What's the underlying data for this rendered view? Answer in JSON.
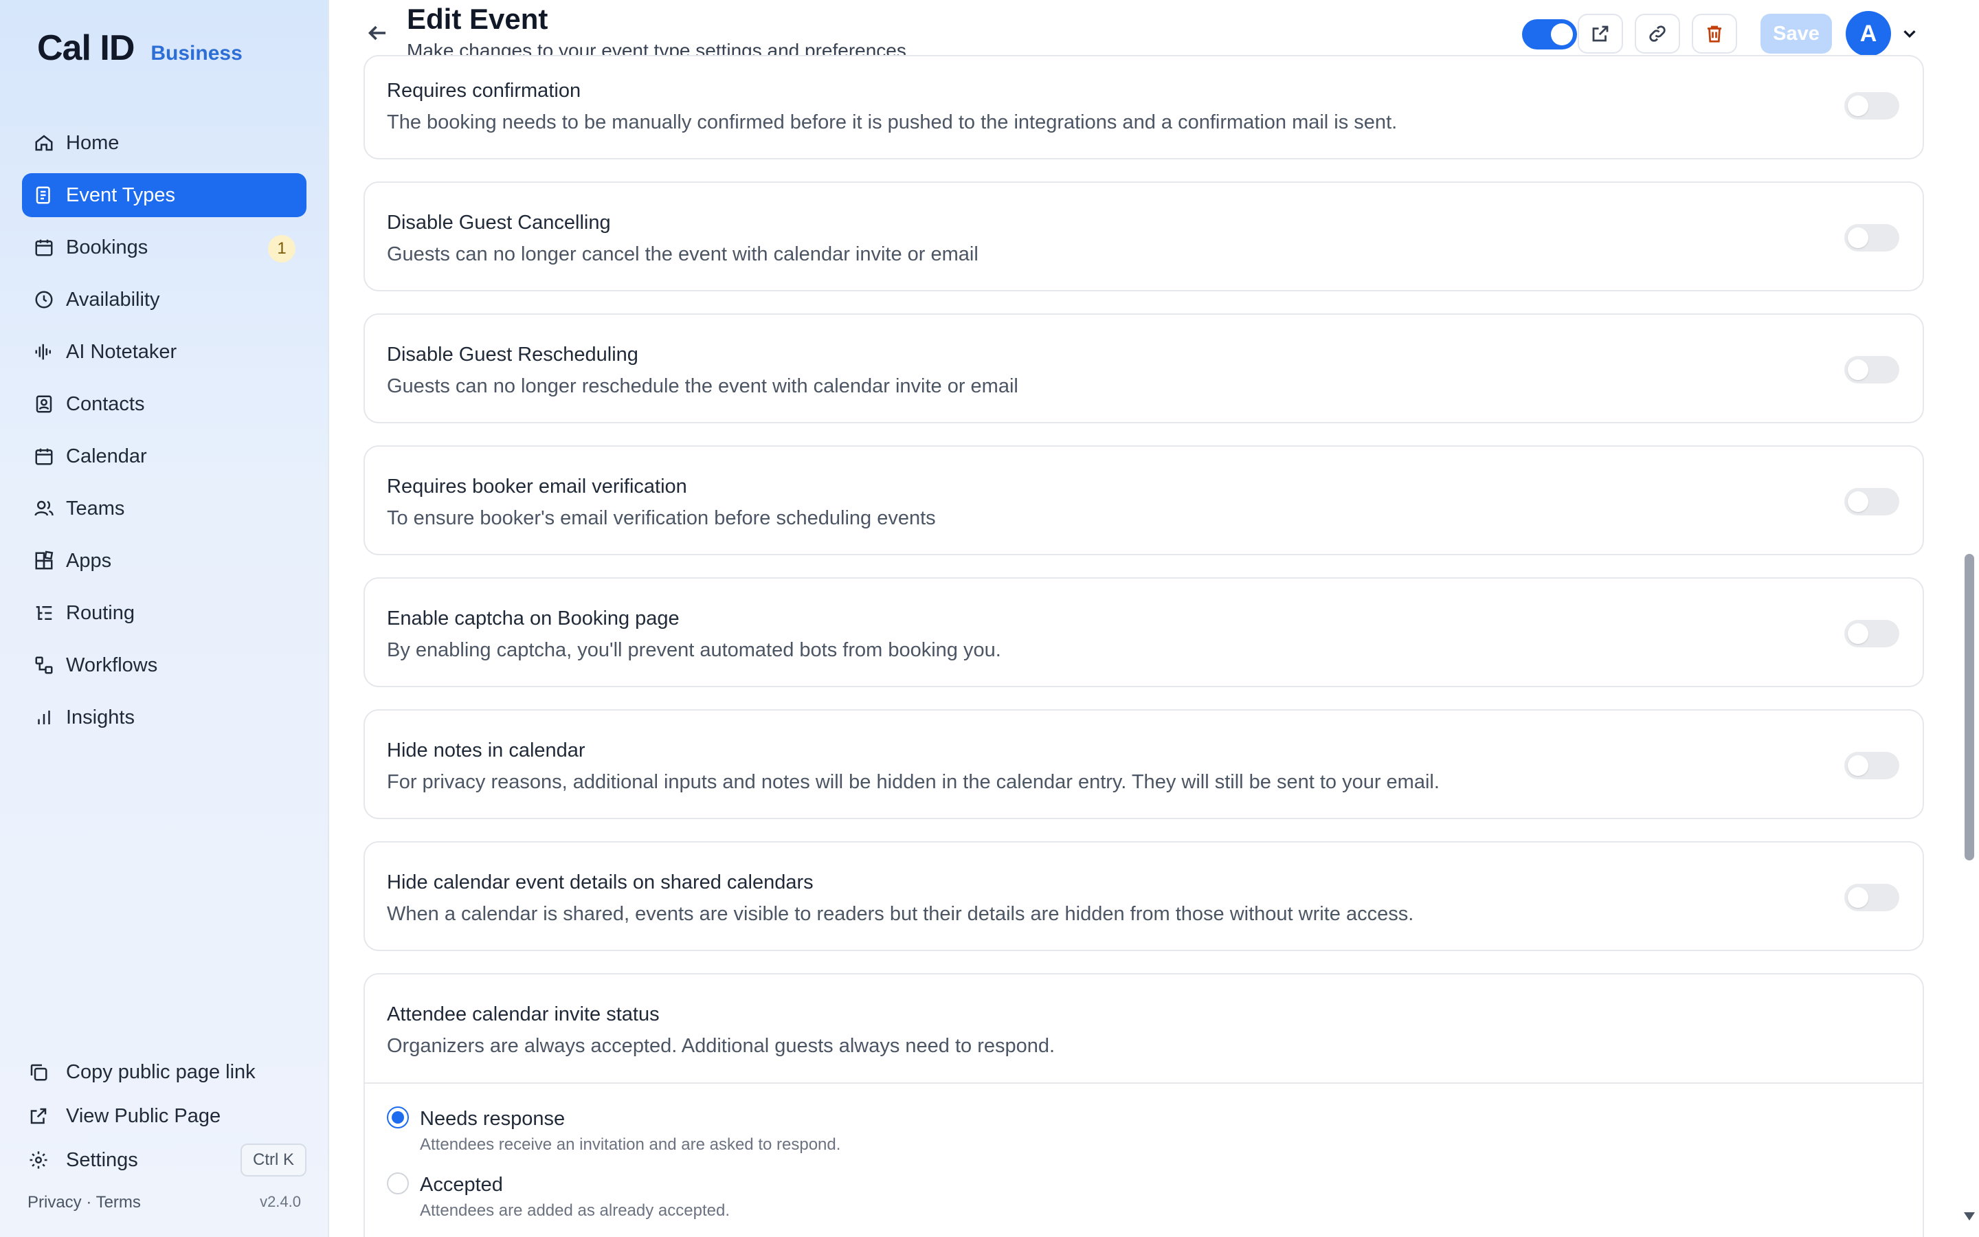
{
  "brand": {
    "logo": "Cal ID",
    "tag": "Business"
  },
  "nav": [
    {
      "label": "Home",
      "icon": "home-icon",
      "active": false
    },
    {
      "label": "Event Types",
      "icon": "event-types-icon",
      "active": true
    },
    {
      "label": "Bookings",
      "icon": "calendar-icon",
      "badge": "1",
      "active": false
    },
    {
      "label": "Availability",
      "icon": "clock-icon",
      "active": false
    },
    {
      "label": "AI Notetaker",
      "icon": "audio-wave-icon",
      "active": false
    },
    {
      "label": "Contacts",
      "icon": "contact-icon",
      "active": false
    },
    {
      "label": "Calendar",
      "icon": "calendar-icon",
      "active": false
    },
    {
      "label": "Teams",
      "icon": "users-icon",
      "active": false
    },
    {
      "label": "Apps",
      "icon": "grid-icon",
      "active": false
    },
    {
      "label": "Routing",
      "icon": "routing-icon",
      "active": false
    },
    {
      "label": "Workflows",
      "icon": "workflow-icon",
      "active": false
    },
    {
      "label": "Insights",
      "icon": "bar-chart-icon",
      "active": false
    }
  ],
  "sidebar_bottom": {
    "copy_link": "Copy public page link",
    "view_public": "View Public Page",
    "settings": "Settings",
    "shortcut": "Ctrl K",
    "privacy_terms": "Privacy · Terms",
    "version": "v2.4.0"
  },
  "header": {
    "title": "Edit Event",
    "subtitle": "Make changes to your event type settings and preferences",
    "save_label": "Save",
    "avatar_initial": "A",
    "accent": "#1d6cf0"
  },
  "settings": [
    {
      "title": "Requires confirmation",
      "desc": "The booking needs to be manually confirmed before it is pushed to the integrations and a confirmation mail is sent.",
      "enabled": false
    },
    {
      "title": "Disable Guest Cancelling",
      "desc": "Guests can no longer cancel the event with calendar invite or email",
      "enabled": false
    },
    {
      "title": "Disable Guest Rescheduling",
      "desc": "Guests can no longer reschedule the event with calendar invite or email",
      "enabled": false
    },
    {
      "title": "Requires booker email verification",
      "desc": "To ensure booker's email verification before scheduling events",
      "enabled": false
    },
    {
      "title": "Enable captcha on Booking page",
      "desc": "By enabling captcha, you'll prevent automated bots from booking you.",
      "enabled": false
    },
    {
      "title": "Hide notes in calendar",
      "desc": "For privacy reasons, additional inputs and notes will be hidden in the calendar entry. They will still be sent to your email.",
      "enabled": false
    },
    {
      "title": "Hide calendar event details on shared calendars",
      "desc": "When a calendar is shared, events are visible to readers but their details are hidden from those without write access.",
      "enabled": false
    }
  ],
  "invite_status": {
    "title": "Attendee calendar invite status",
    "desc": "Organizers are always accepted. Additional guests always need to respond.",
    "options": [
      {
        "label": "Needs response",
        "desc": "Attendees receive an invitation and are asked to respond.",
        "checked": true
      },
      {
        "label": "Accepted",
        "desc": "Attendees are added as already accepted.",
        "checked": false
      }
    ]
  }
}
